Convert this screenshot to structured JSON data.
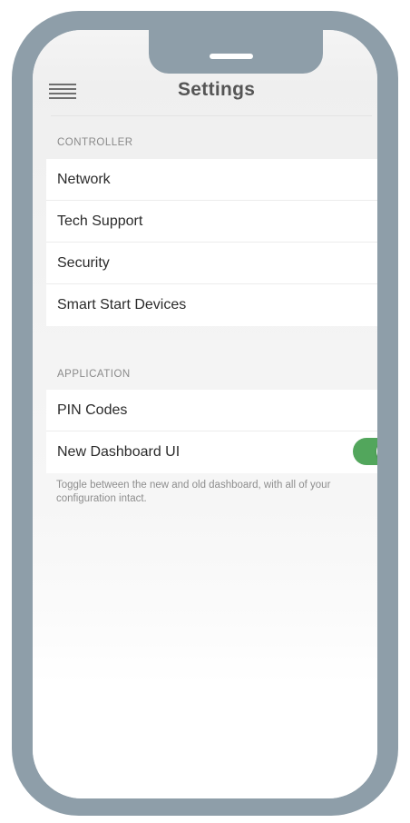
{
  "header": {
    "title": "Settings",
    "menu_icon": "hamburger-menu-icon"
  },
  "controller": {
    "label": "CONTROLLER",
    "items": [
      {
        "label": "Network",
        "icon": "chevron-right-icon"
      },
      {
        "label": "Tech Support",
        "icon": "chevron-right-icon"
      },
      {
        "label": "Security",
        "icon": "chevron-right-icon"
      },
      {
        "label": "Smart Start Devices",
        "icon": "chevron-right-icon"
      }
    ]
  },
  "application": {
    "label": "APPLICATION",
    "items": [
      {
        "label": "PIN Codes",
        "icon": "chevron-right-icon"
      }
    ],
    "toggle": {
      "label": "New Dashboard UI",
      "enabled": true,
      "color": "#52a65c"
    },
    "helper": "Toggle between the new and old dashboard, with all of your configuration intact."
  },
  "colors": {
    "frame": "#8e9ea9",
    "accent": "#52a65c"
  }
}
